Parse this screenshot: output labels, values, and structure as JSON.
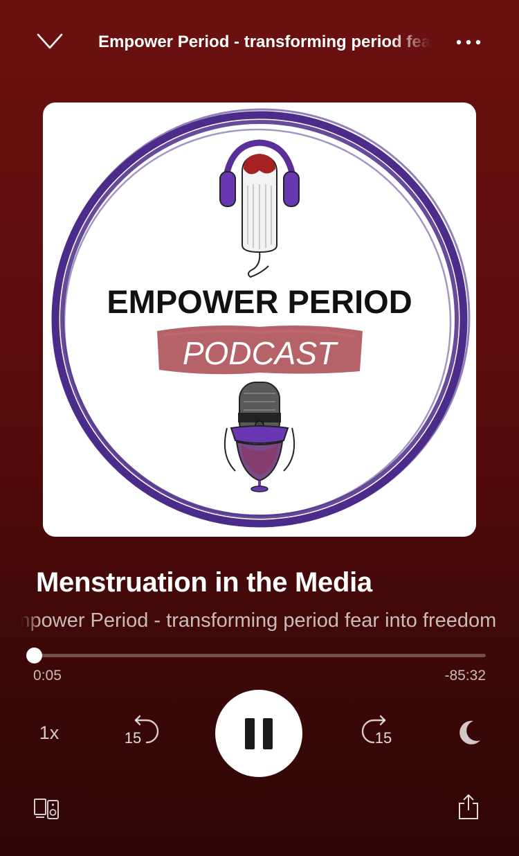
{
  "header": {
    "title": "Empower Period - transforming period fear into freedom",
    "collapse_icon": "chevron-down-icon",
    "more_icon": "more-horizontal-icon"
  },
  "artwork": {
    "line1": "EMPOWER PERIOD",
    "line2": "PODCAST",
    "ring_color": "#4b2c8a",
    "accent_color": "#a8484e"
  },
  "track": {
    "title": "Menstruation in the Media",
    "show": "Empower Period - transforming period fear into freedom"
  },
  "progress": {
    "elapsed": "0:05",
    "remaining": "-85:32",
    "fraction": 0.001
  },
  "controls": {
    "speed_label": "1x",
    "rewind_label": "15",
    "forward_label": "15",
    "play_pause_state": "playing"
  },
  "colors": {
    "background_top": "#6b1010",
    "background_bottom": "#2e0606",
    "primary_text": "#ffffff"
  }
}
